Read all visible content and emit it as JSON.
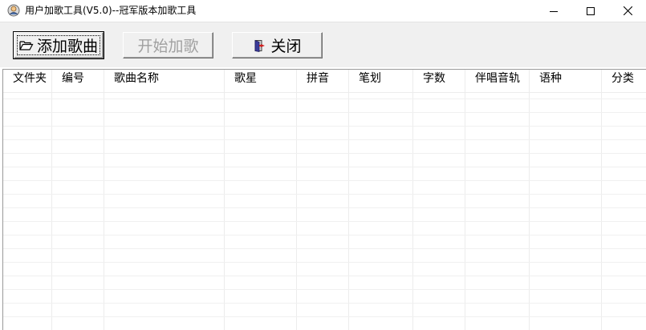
{
  "window": {
    "title": "用户加歌工具(V5.0)--冠军版本加歌工具"
  },
  "toolbar": {
    "add_label": "添加歌曲",
    "start_label": "开始加歌",
    "close_label": "关闭"
  },
  "grid": {
    "columns": [
      "文件夹",
      "编号",
      "歌曲名称",
      "歌星",
      "拼音",
      "笔划",
      "字数",
      "伴唱音轨",
      "语种",
      "分类"
    ],
    "rows": []
  },
  "icons": {
    "app": "app-icon",
    "add": "open-folder-icon",
    "close": "exit-door-icon"
  }
}
